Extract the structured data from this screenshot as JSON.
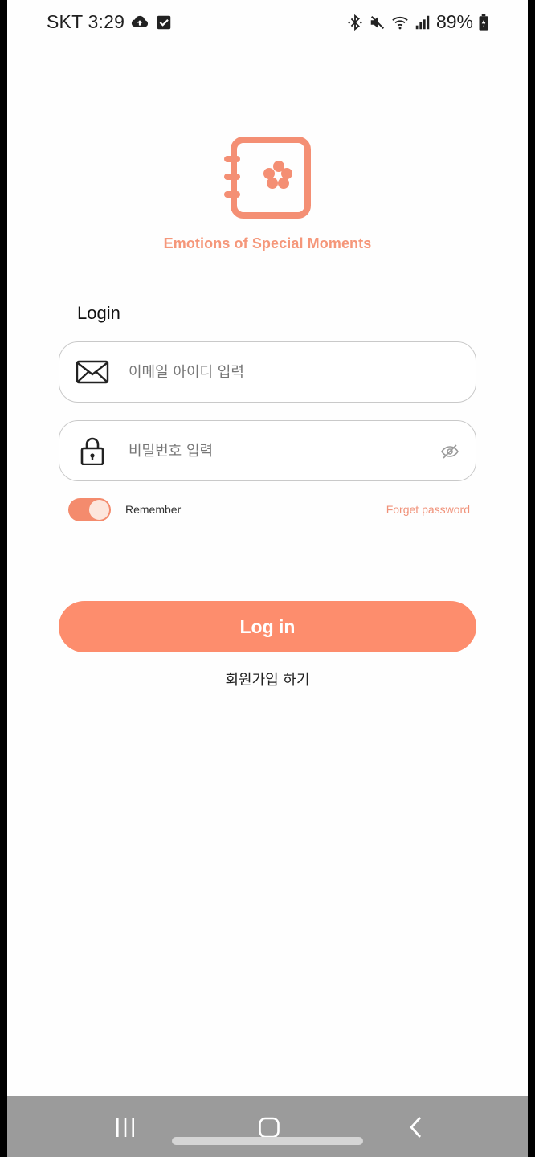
{
  "status_bar": {
    "carrier_time": "SKT 3:29",
    "battery": "89%",
    "left_icons": [
      "cloud-upload-icon",
      "checkbox-icon"
    ],
    "right_icons": [
      "bluetooth-icon",
      "mute-icon",
      "wifi-icon",
      "signal-icon",
      "battery-icon"
    ]
  },
  "app": {
    "title": "Emotions of Special Moments",
    "logo": "notebook-flower-logo",
    "accent_color": "#fd8d6d"
  },
  "login": {
    "heading": "Login",
    "email_placeholder": "이메일 아이디 입력",
    "password_placeholder": "비밀번호 입력",
    "remember_label": "Remember",
    "remember_on": true,
    "forget_password": "Forget password",
    "login_button": "Log in",
    "signup_link": "회원가입 하기"
  },
  "nav_bar": {
    "buttons": [
      "recents-icon",
      "home-icon",
      "back-icon"
    ]
  }
}
